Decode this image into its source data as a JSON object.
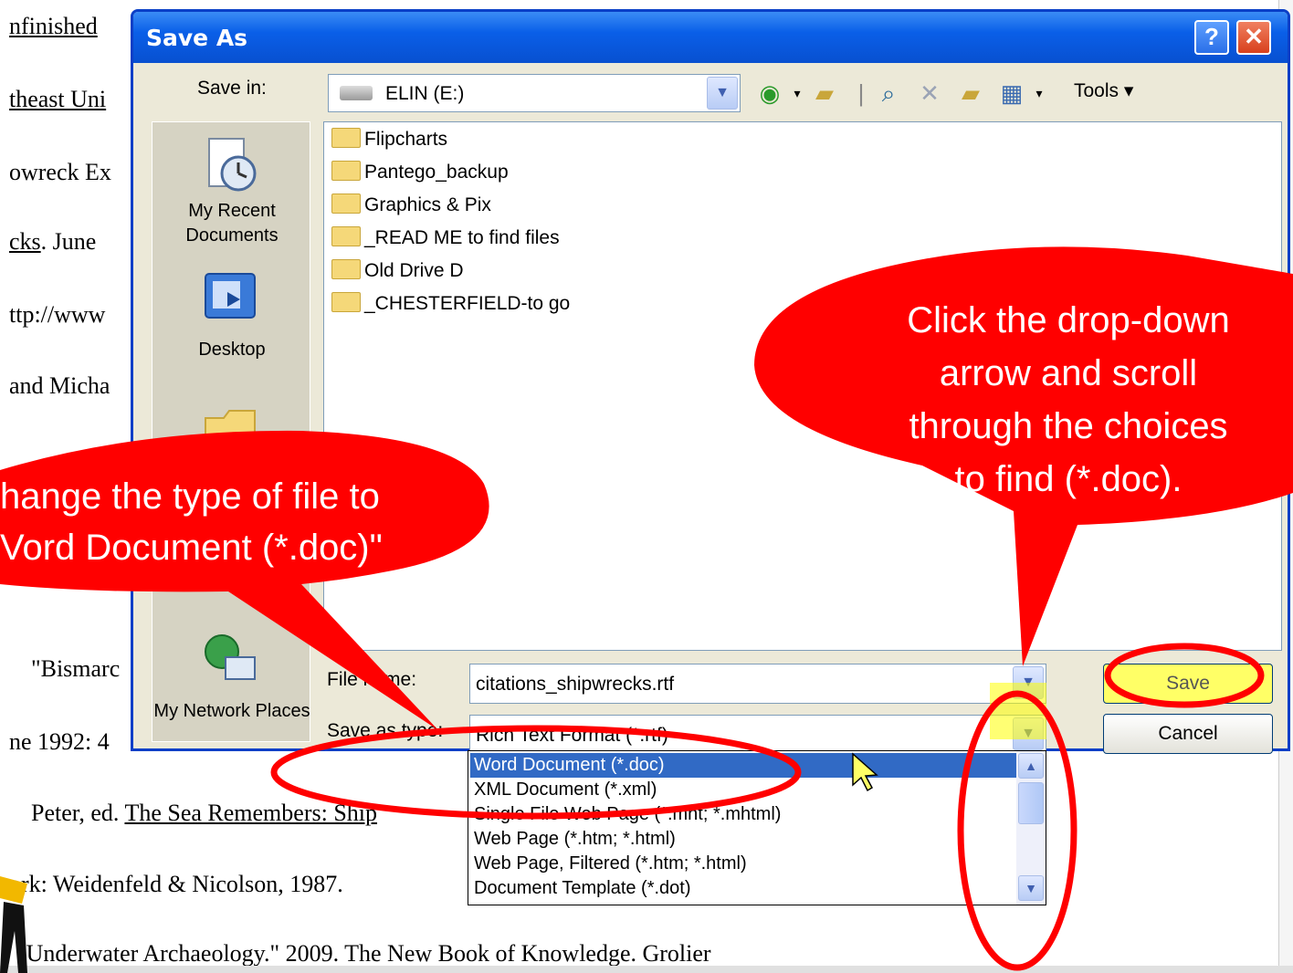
{
  "background_doc": {
    "lines": [
      {
        "text": "nfinished",
        "underline": true
      },
      {
        "text": "theast Uni",
        "underline": true
      },
      {
        "text": "owreck Ex",
        "underline": false
      },
      {
        "text": "cks",
        "underline": true,
        "suffix": ". June"
      },
      {
        "text": "ttp://www",
        "underline": false
      },
      {
        "text": "and Micha",
        "underline": false
      },
      {
        "text": "\"Bismarc",
        "underline": false
      },
      {
        "text": "ne 1992: 4",
        "underline": false
      },
      {
        "text": "Peter, ed. ",
        "underline": false,
        "u_part": "The Sea Remembers: Ship"
      },
      {
        "text": "ork: Weidenfeld & Nicolson, 1987.",
        "underline": false
      },
      {
        "text": "\"Underwater Archaeology.\" 2009. The New Book of Knowledge. Grolier",
        "underline": false
      }
    ]
  },
  "dialog": {
    "title": "Save As",
    "help_label": "?",
    "close_label": "✕",
    "save_in_label": "Save in:",
    "save_in_value": "ELIN (E:)",
    "tools_label": "Tools ▾",
    "places": [
      {
        "label": "My Recent Documents",
        "icon": "recent-documents-icon"
      },
      {
        "label": "Desktop",
        "icon": "desktop-icon"
      },
      {
        "label": "My Network Places",
        "icon": "network-places-icon"
      }
    ],
    "folders": [
      "Flipcharts",
      "Pantego_backup",
      "Graphics & Pix",
      "_READ ME to find files",
      "Old Drive D",
      "_CHESTERFIELD-to go"
    ],
    "file_name_label": "File name:",
    "file_name_value": "citations_shipwrecks.rtf",
    "save_as_type_label": "Save as type:",
    "save_as_type_value": "Rich Text Format (*.rtf)",
    "save_button": "Save",
    "cancel_button": "Cancel"
  },
  "type_dropdown": {
    "options": [
      "Word Document (*.doc)",
      "XML Document (*.xml)",
      "Single File Web Page (*.mht; *.mhtml)",
      "Web Page (*.htm; *.html)",
      "Web Page, Filtered (*.htm; *.html)",
      "Document Template (*.dot)"
    ],
    "selected_index": 0
  },
  "callouts": {
    "right": [
      "Click the drop-down",
      "arrow and scroll",
      "through the choices",
      "to find (*.doc)."
    ],
    "left": [
      "hange the type of file to",
      "Vord Document (*.doc)\""
    ]
  },
  "colors": {
    "callout_red": "#ff0000",
    "title_blue": "#0a5fe8",
    "selection_blue": "#316ac5",
    "highlight_yellow": "#ffff66"
  }
}
